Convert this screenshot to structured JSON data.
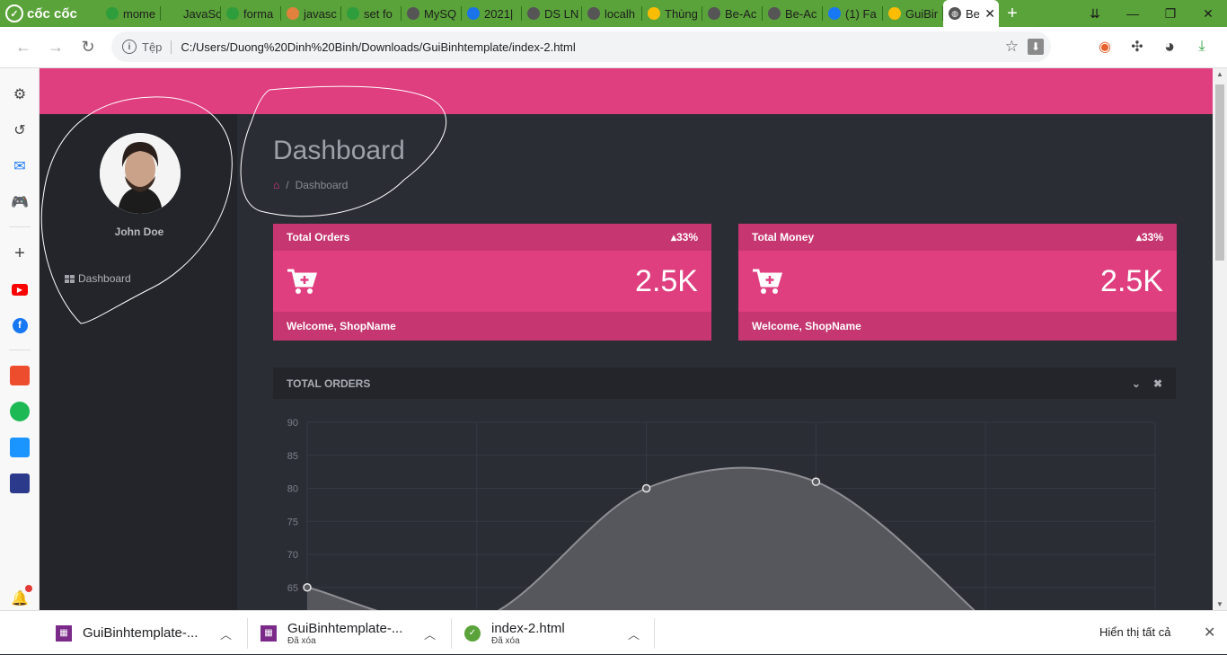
{
  "browser": {
    "brand": "cốc cốc",
    "tabs": [
      {
        "title": "mome",
        "fav_color": "#2e9d3c"
      },
      {
        "title": "JavaSc",
        "fav_color": "#5aa33a"
      },
      {
        "title": "forma",
        "fav_color": "#2e9d3c"
      },
      {
        "title": "javasc",
        "fav_color": "#e0823d"
      },
      {
        "title": "set fo",
        "fav_color": "#2e9d3c"
      },
      {
        "title": "MySQ",
        "fav_color": "#555555"
      },
      {
        "title": "2021|",
        "fav_color": "#1a73e8"
      },
      {
        "title": "DS LN",
        "fav_color": "#555555"
      },
      {
        "title": "localh",
        "fav_color": "#555555"
      },
      {
        "title": "Thùng",
        "fav_color": "#fbbc04"
      },
      {
        "title": "Be-Ac",
        "fav_color": "#555555"
      },
      {
        "title": "Be-Ac",
        "fav_color": "#555555"
      },
      {
        "title": "(1) Fa",
        "fav_color": "#1877f2"
      },
      {
        "title": "GuiBir",
        "fav_color": "#fbbc04"
      }
    ],
    "active_tab": {
      "title": "Be"
    },
    "new_tab": "+",
    "address": {
      "security_label": "Tệp",
      "url": "C:/Users/Duong%20Dinh%20Binh/Downloads/GuiBinhtemplate/index-2.html"
    }
  },
  "app": {
    "accent": "#df3e7f",
    "user_name": "John Doe",
    "nav": [
      {
        "label": "Dashboard"
      }
    ],
    "page_title": "Dashboard",
    "breadcrumb": {
      "current": "Dashboard",
      "separator": "/"
    },
    "cards": [
      {
        "title": "Total Orders",
        "change": "33%",
        "value": "2.5K",
        "footer": "Welcome, ShopName"
      },
      {
        "title": "Total Money",
        "change": "33%",
        "value": "2.5K",
        "footer": "Welcome, ShopName"
      }
    ],
    "panel": {
      "title": "TOTAL ORDERS"
    }
  },
  "chart_data": {
    "type": "area",
    "title": "",
    "xlabel": "",
    "ylabel": "",
    "y_ticks": [
      90,
      85,
      80,
      75,
      70,
      65
    ],
    "ylim": [
      60,
      90
    ],
    "x_index": [
      0,
      1,
      2,
      3,
      4,
      5
    ],
    "series": [
      {
        "values": [
          65,
          60,
          80,
          81,
          60
        ]
      }
    ],
    "grid": true
  },
  "downloads": {
    "items": [
      {
        "name": "GuiBinhtemplate-...",
        "status": ""
      },
      {
        "name": "GuiBinhtemplate-...",
        "status": "Đã xóa"
      },
      {
        "name": "index-2.html",
        "status": "Đã xóa"
      }
    ],
    "show_all": "Hiển thị tất cả"
  }
}
